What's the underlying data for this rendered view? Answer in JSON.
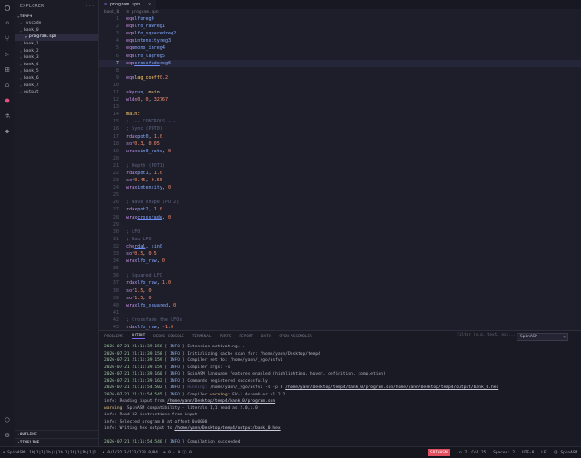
{
  "activity": {
    "icons": [
      "files-icon",
      "search-icon",
      "source-control-icon",
      "run-debug-icon",
      "extensions-icon",
      "remote-icon",
      "spinasm-icon",
      "testing-icon",
      "chip-icon"
    ],
    "bottom": [
      "account-icon",
      "settings-icon"
    ]
  },
  "sidebar": {
    "title": "EXPLORER",
    "section": "TEMP4",
    "items": [
      {
        "label": ".vscode",
        "twisty": "›",
        "indent": 0
      },
      {
        "label": "bank_0",
        "twisty": "⌄",
        "indent": 0
      },
      {
        "label": "program.spn",
        "twisty": "",
        "indent": 1,
        "selected": true
      },
      {
        "label": "bank_1",
        "twisty": "›",
        "indent": 0
      },
      {
        "label": "bank_2",
        "twisty": "›",
        "indent": 0
      },
      {
        "label": "bank_3",
        "twisty": "›",
        "indent": 0
      },
      {
        "label": "bank_4",
        "twisty": "›",
        "indent": 0
      },
      {
        "label": "bank_5",
        "twisty": "›",
        "indent": 0
      },
      {
        "label": "bank_6",
        "twisty": "›",
        "indent": 0
      },
      {
        "label": "bank_7",
        "twisty": "›",
        "indent": 0
      },
      {
        "label": "output",
        "twisty": "›",
        "indent": 0
      }
    ],
    "outline": "OUTLINE",
    "timeline": "TIMELINE"
  },
  "editor": {
    "tab_label": "program.spn",
    "breadcrumb": "bank_0 › ≡ program.spn"
  },
  "panel": {
    "tabs": [
      "PROBLEMS",
      "OUTPUT",
      "DEBUG CONSOLE",
      "TERMINAL",
      "PORTS",
      "REPORT",
      "DATA",
      "SPIN ASSEMBLER"
    ],
    "active_tab": 1,
    "filter_placeholder": "Filter (e.g. text, exc...",
    "channel": "SpinASM"
  },
  "statusbar": {
    "left": [
      "⊗ SpinASM: 1b|1|1|1b|1|1b|1|1b|1|1b|1|1",
      "⚭ 0/7/32 3/123/128 0/84",
      "⊗ 0 ⚠ 0 ⓘ 0"
    ],
    "right": [
      "Ln 7, Col 25",
      "Spaces: 2",
      "UTF-8",
      "LF",
      "{} SpinASM"
    ],
    "badge": "SPINASM"
  }
}
